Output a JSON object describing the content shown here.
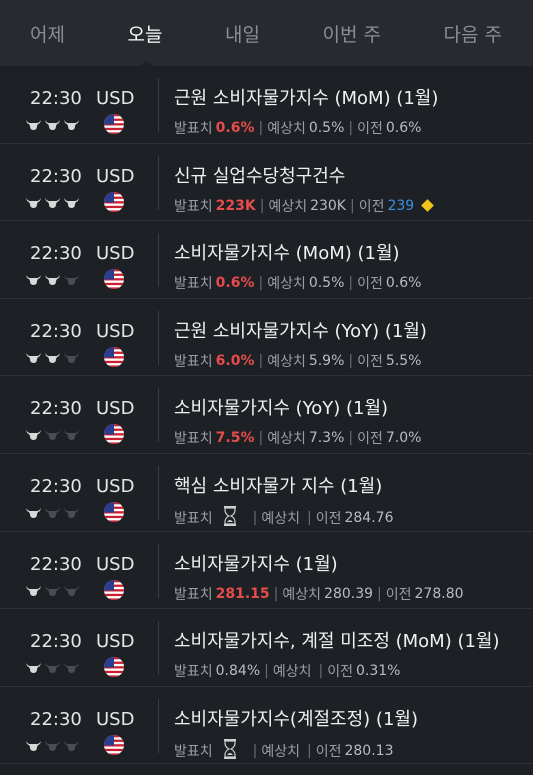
{
  "tabs": [
    {
      "label": "어제"
    },
    {
      "label": "오늘"
    },
    {
      "label": "내일"
    },
    {
      "label": "이번 주"
    },
    {
      "label": "다음 주"
    }
  ],
  "labels": {
    "actual": "발표치",
    "forecast": "예상치",
    "previous": "이전",
    "sep": "|"
  },
  "colors": {
    "bull_active": "#d8d8d8",
    "bull_inactive": "#4a4d52",
    "actual_red": "#e64c4c",
    "prev_blue": "#3d8fe0",
    "diamond": "#f0c419"
  },
  "events": [
    {
      "time": "22:30",
      "currency": "USD",
      "importance": 3,
      "title": "근원 소비자물가지수 (MoM) (1월)",
      "actual": "0.6%",
      "forecast": "0.5%",
      "previous": "0.6%"
    },
    {
      "time": "22:30",
      "currency": "USD",
      "importance": 3,
      "title": "신규 실업수당청구건수",
      "actual": "223K",
      "forecast": "230K",
      "previous": "239"
    },
    {
      "time": "22:30",
      "currency": "USD",
      "importance": 2,
      "title": "소비자물가지수 (MoM) (1월)",
      "actual": "0.6%",
      "forecast": "0.5%",
      "previous": "0.6%"
    },
    {
      "time": "22:30",
      "currency": "USD",
      "importance": 2,
      "title": "근원 소비자물가지수 (YoY) (1월)",
      "actual": "6.0%",
      "forecast": "5.9%",
      "previous": "5.5%"
    },
    {
      "time": "22:30",
      "currency": "USD",
      "importance": 1,
      "title": "소비자물가지수 (YoY) (1월)",
      "actual": "7.5%",
      "forecast": "7.3%",
      "previous": "7.0%"
    },
    {
      "time": "22:30",
      "currency": "USD",
      "importance": 1,
      "title": "핵심 소비자물가 지수 (1월)",
      "actual": "",
      "forecast": "",
      "previous": "284.76"
    },
    {
      "time": "22:30",
      "currency": "USD",
      "importance": 1,
      "title": "소비자물가지수 (1월)",
      "actual": "281.15",
      "forecast": "280.39",
      "previous": "278.80"
    },
    {
      "time": "22:30",
      "currency": "USD",
      "importance": 1,
      "title": "소비자물가지수, 계절 미조정 (MoM) (1월)",
      "actual": "0.84%",
      "forecast": "",
      "previous": "0.31%"
    },
    {
      "time": "22:30",
      "currency": "USD",
      "importance": 1,
      "title": "소비자물가지수(계절조정) (1월)",
      "actual": "",
      "forecast": "",
      "previous": "280.13"
    }
  ]
}
